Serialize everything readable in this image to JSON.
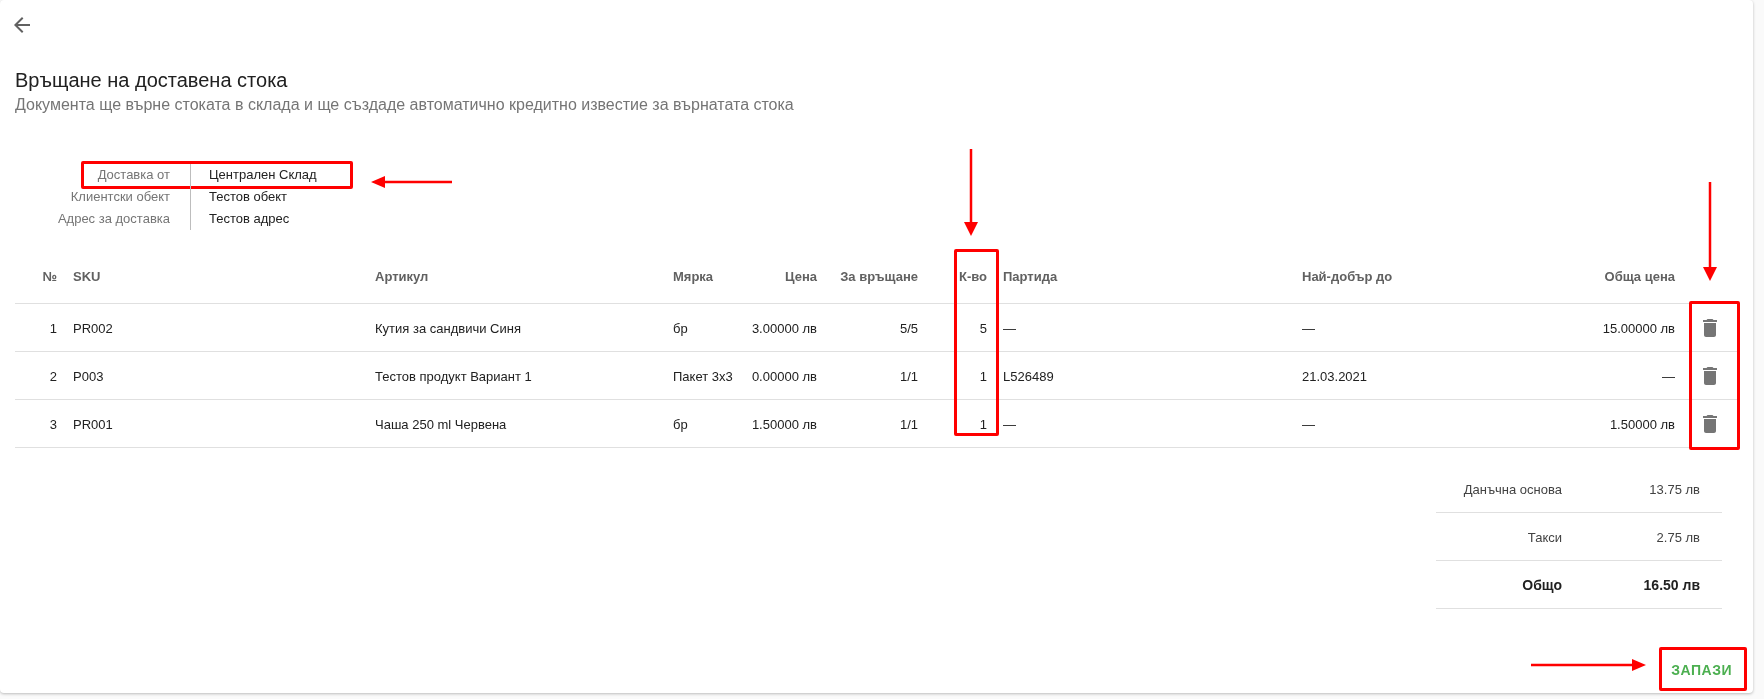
{
  "header": {
    "title": "Връщане на доставена стока",
    "subtitle": "Документа ще върне стоката в склада и ще създаде автоматично кредитно известие за върнатата стока"
  },
  "delivery_info": [
    {
      "label": "Доставка от",
      "value": "Централен Склад",
      "annotated": true
    },
    {
      "label": "Клиентски обект",
      "value": "Тестов обект",
      "annotated": false
    },
    {
      "label": "Адрес за доставка",
      "value": "Тестов адрес",
      "annotated": false
    }
  ],
  "table": {
    "columns": [
      {
        "label": "№",
        "annotated": false
      },
      {
        "label": "SKU",
        "annotated": false
      },
      {
        "label": "Артикул",
        "annotated": false
      },
      {
        "label": "Мярка",
        "annotated": false
      },
      {
        "label": "Цена",
        "annotated": false
      },
      {
        "label": "За връщане",
        "annotated": false
      },
      {
        "label": "К-во",
        "annotated": true
      },
      {
        "label": "Партида",
        "annotated": false
      },
      {
        "label": "Най-добър до",
        "annotated": false
      },
      {
        "label": "Обща цена",
        "annotated": false
      }
    ],
    "action_column": {
      "annotated": true
    },
    "rows": [
      {
        "cells": [
          "1",
          "PR002",
          "Кутия за сандвичи Синя",
          "бр",
          "3.00000 лв",
          "5/5",
          "5",
          "—",
          "—",
          "15.00000 лв"
        ]
      },
      {
        "cells": [
          "2",
          "P003",
          "Тестов продукт Вариант 1",
          "Пакет 3х3",
          "0.00000 лв",
          "1/1",
          "1",
          "L526489",
          "21.03.2021",
          "—"
        ]
      },
      {
        "cells": [
          "3",
          "PR001",
          "Чаша 250 ml Червена",
          "бр",
          "1.50000 лв",
          "1/1",
          "1",
          "—",
          "—",
          "1.50000 лв"
        ]
      }
    ]
  },
  "totals": [
    {
      "label": "Данъчна основа",
      "value": "13.75 лв",
      "kind": "line"
    },
    {
      "label": "Такси",
      "value": "2.75 лв",
      "kind": "line"
    },
    {
      "label": "Общо",
      "value": "16.50 лв",
      "kind": "total"
    }
  ],
  "save_button": {
    "label": "ЗАПАЗИ",
    "annotated": true
  }
}
